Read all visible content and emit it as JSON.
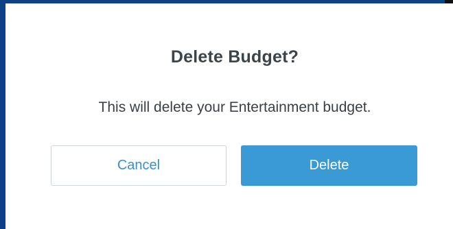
{
  "dialog": {
    "title": "Delete Budget?",
    "message": "This will delete your Entertainment budget.",
    "cancel_label": "Cancel",
    "delete_label": "Delete"
  },
  "colors": {
    "frame_border": "#0f3f86",
    "primary": "#3a9ad6",
    "cancel_text": "#3a8fc6",
    "text": "#3c4349"
  }
}
